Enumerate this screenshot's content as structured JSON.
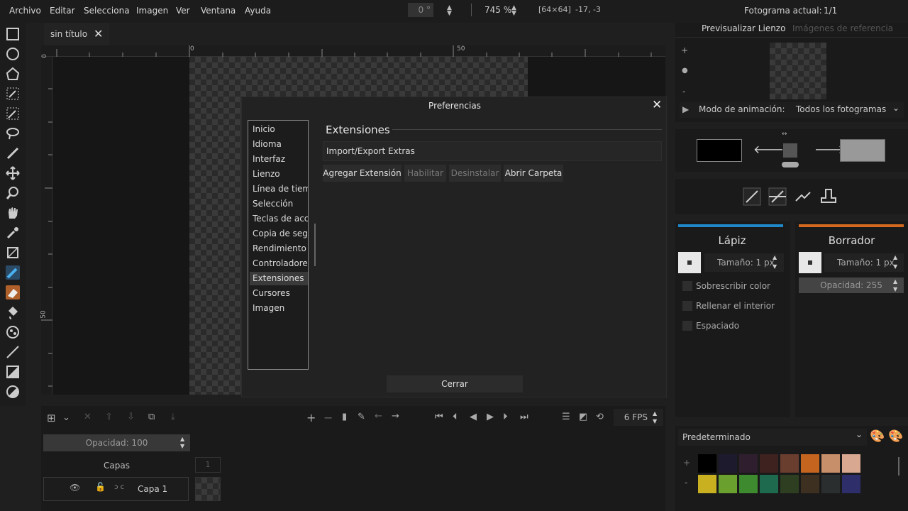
{
  "menu": [
    "Archivo",
    "Editar",
    "Selecciona",
    "Imagen",
    "Ver",
    "Ventana",
    "Ayuda"
  ],
  "top": {
    "rotation": "0 °",
    "zoom": "745 %",
    "size": "[64×64]",
    "coords": "-17, -3",
    "frame_label": "Fotograma actual:",
    "frame_value": "1/1"
  },
  "tab": {
    "title": "sin título"
  },
  "rulers": {
    "h0": "0",
    "h50": "50",
    "hneg": "0",
    "v50": "50"
  },
  "dialog": {
    "title": "Preferencias",
    "section": "Extensiones",
    "list_item": "Import/Export Extras",
    "btn_add": "Agregar Extensión",
    "btn_enable": "Habilitar",
    "btn_uninstall": "Desinstalar",
    "btn_folder": "Abrir Carpeta",
    "btn_close": "Cerrar",
    "sidebar": [
      "Inicio",
      "Idioma",
      "Interfaz",
      "Lienzo",
      "Línea de tiemp",
      "Selección",
      "Teclas de acce",
      "Copia de segu",
      "Rendimiento",
      "Controladores",
      "Extensiones",
      "Cursores",
      "Imagen"
    ],
    "selected_index": 10
  },
  "right": {
    "tab_preview": "Previsualizar Lienzo",
    "tab_refs": "Imágenes de referencia",
    "zoom_plus": "+",
    "zoom_minus": "-",
    "anim_label": "Modo de animación:",
    "anim_value": "Todos los fotogramas"
  },
  "tools": {
    "left_title": "Lápiz",
    "left_size": "Tamaño: 1 px",
    "right_title": "Borrador",
    "right_size": "Tamaño: 1 px",
    "right_opacity": "Opacidad: 255",
    "opt1": "Sobrescribir color",
    "opt2": "Rellenar el interior",
    "opt3": "Espaciado",
    "left_color": "#1e88c8",
    "right_color": "#d2691e"
  },
  "layers": {
    "opacity": "Opacidad: 100",
    "header": "Capas",
    "frame_num": "1",
    "layer_name": "Capa 1",
    "fps": "6 FPS"
  },
  "palette": {
    "name": "Predeterminado",
    "plus": "+",
    "minus": "-",
    "row1": [
      "#000000",
      "#1e1a2e",
      "#2e1e2e",
      "#3e2220",
      "#6a3e2e",
      "#c4641e",
      "#c8906a",
      "#d8a890"
    ],
    "row2": [
      "#c8b020",
      "#6aa02e",
      "#3e8a2e",
      "#1e6a4e",
      "#2e3e20",
      "#3e3020",
      "#2a2e2e",
      "#2e2e6a"
    ]
  },
  "colors": {
    "primary": "#000000",
    "secondary": "#999999"
  }
}
